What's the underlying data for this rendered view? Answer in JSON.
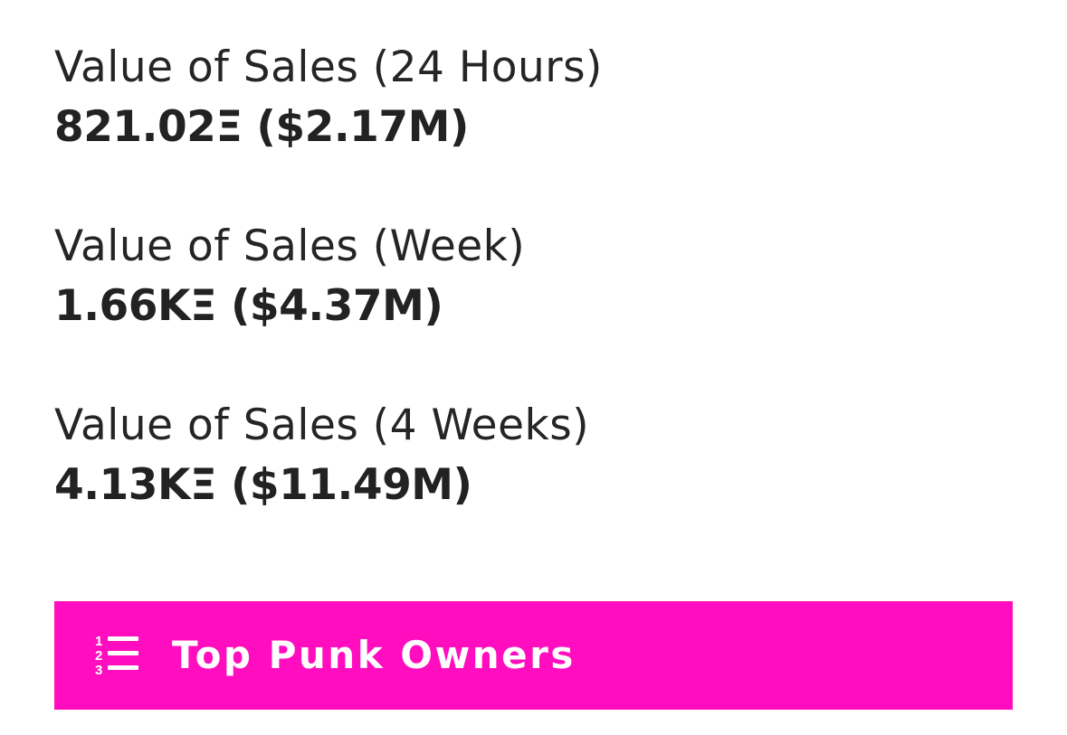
{
  "stats": [
    {
      "label": "Value of Sales (24 Hours)",
      "value": "821.02Ξ ($2.17M)"
    },
    {
      "label": "Value of Sales (Week)",
      "value": "1.66KΞ ($4.37M)"
    },
    {
      "label": "Value of Sales (4 Weeks)",
      "value": "4.13KΞ ($11.49M)"
    }
  ],
  "top_owners_button": {
    "label": "Top Punk Owners",
    "icon": "ordered-list-icon"
  },
  "colors": {
    "accent": "#ff0dbe",
    "text": "#222222",
    "button_text": "#ffffff"
  }
}
